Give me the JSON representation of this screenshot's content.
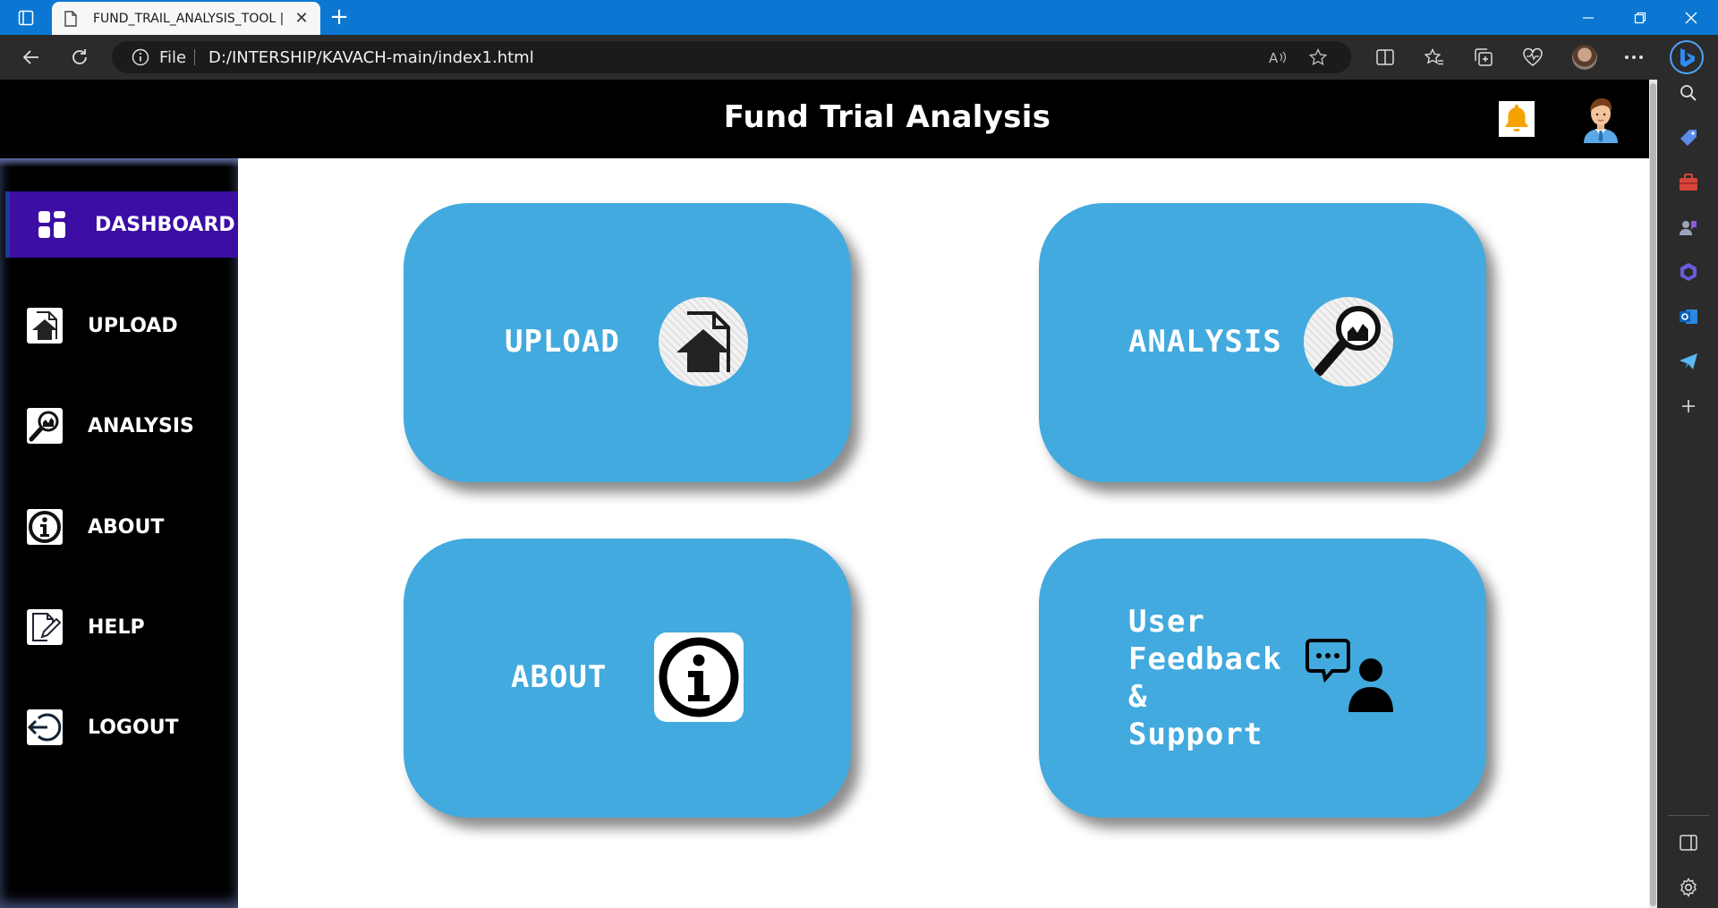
{
  "browser": {
    "tab_title": "FUND_TRAIL_ANALYSIS_TOOL | E",
    "url_scheme_label": "File",
    "url": "D:/INTERSHIP/KAVACH-main/index1.html"
  },
  "header": {
    "title": "Fund Trial Analysis"
  },
  "sidebar": {
    "items": [
      {
        "label": "DASHBOARD",
        "icon": "dashboard-grid-icon",
        "active": true
      },
      {
        "label": "UPLOAD",
        "icon": "upload-file-icon",
        "active": false
      },
      {
        "label": "ANALYSIS",
        "icon": "magnifier-chart-icon",
        "active": false
      },
      {
        "label": "ABOUT",
        "icon": "info-icon",
        "active": false
      },
      {
        "label": "HELP",
        "icon": "edit-document-icon",
        "active": false
      },
      {
        "label": "LOGOUT",
        "icon": "logout-icon",
        "active": false
      }
    ]
  },
  "cards": [
    {
      "label": "UPLOAD",
      "icon": "upload-file-icon"
    },
    {
      "label": "ANALYSIS",
      "icon": "magnifier-chart-icon"
    },
    {
      "label": "ABOUT",
      "icon": "info-icon"
    },
    {
      "label_lines": [
        "User",
        "Feedback",
        "&",
        "Support"
      ],
      "icon": "feedback-support-icon"
    }
  ],
  "colors": {
    "card_bg": "#42aade",
    "sidebar_active": "#3c0ea3",
    "header_bg": "#000000",
    "bell": "#f5a300"
  }
}
